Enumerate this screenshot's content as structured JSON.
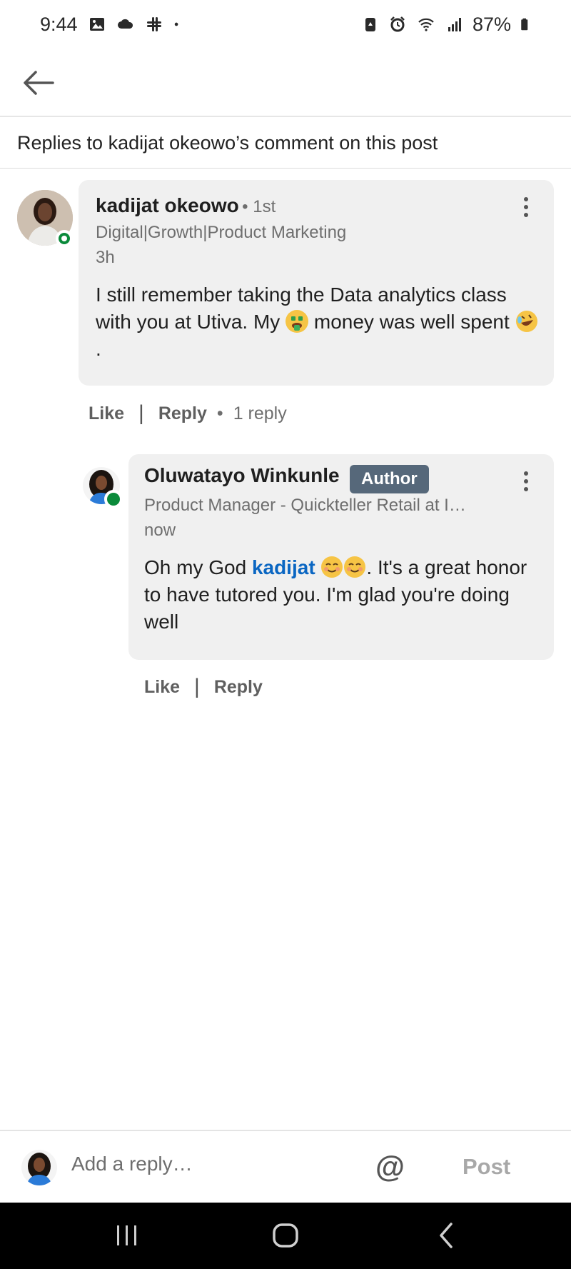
{
  "status_bar": {
    "time": "9:44",
    "battery": "87%",
    "icons": [
      "image-icon",
      "cloud-icon",
      "slack-icon",
      "dot-icon",
      "battery-saver-icon",
      "alarm-icon",
      "wifi-icon",
      "signal-icon",
      "battery-icon"
    ]
  },
  "top_bar": {
    "back_icon": "arrow-left-icon"
  },
  "subheader": {
    "title": "Replies to kadijat okeowo’s comment on this post"
  },
  "comment": {
    "author": "kadijat okeowo",
    "degree": "• 1st",
    "headline": "Digital|Growth|Product Marketing",
    "time": "3h",
    "text_part1": "I still remember taking the Data analytics class with you at Utiva. My ",
    "text_part2": " money was well spent ",
    "text_part3": ".",
    "like_label": "Like",
    "reply_label": "Reply",
    "replies_count": "1 reply"
  },
  "reply": {
    "author": "Oluwatayo Winkunle",
    "badge": "Author",
    "headline": "Product Manager - Quickteller Retail at I…",
    "time": "now",
    "text_part1": "Oh my God ",
    "mention": "kadijat",
    "text_part2": ". It's a great honor to have tutored you. I'm glad you're doing well",
    "like_label": "Like",
    "reply_label": "Reply"
  },
  "reply_bar": {
    "placeholder": "Add a reply…",
    "at_symbol": "@",
    "post_label": "Post"
  },
  "colors": {
    "mention": "#0a66c2",
    "author_badge": "#56687a",
    "online": "#0a8a3a",
    "bubble": "#f0f0f0"
  }
}
